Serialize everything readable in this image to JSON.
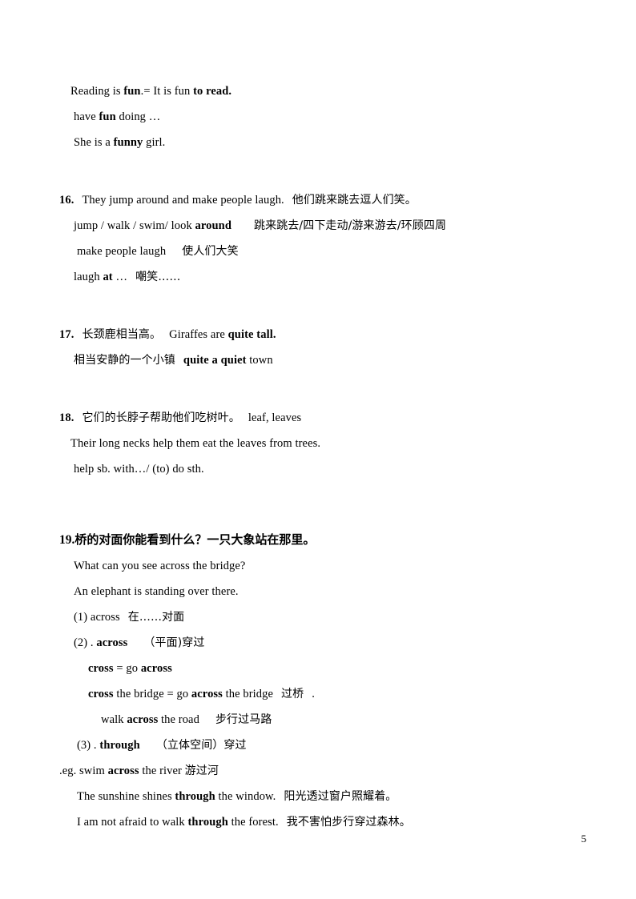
{
  "document": {
    "page_number": "5",
    "background_color": "#ffffff",
    "text_color": "#000000"
  },
  "blocks": {
    "intro": {
      "line1_a": "Reading is ",
      "line1_b": "fun",
      "line1_c": ".= It is fun ",
      "line1_d": "to read.",
      "line2_a": "have ",
      "line2_b": "fun",
      "line2_c": " doing …",
      "line3_a": "She is a ",
      "line3_b": "funny",
      "line3_c": " girl."
    },
    "item16": {
      "number": "16.",
      "title_en": "They jump around and make people laugh.",
      "title_cn": "他们跳来跳去逗人们笑。",
      "line2_a": "jump / walk / swim/ look ",
      "line2_b": "around",
      "line2_cn": "跳来跳去/四下走动/游来游去/环顾四周",
      "line3_en": "make people laugh",
      "line3_cn": "使人们大笑",
      "line4_a": "laugh ",
      "line4_b": "at",
      "line4_c": " …",
      "line4_cn": "嘲笑……"
    },
    "item17": {
      "number": "17.",
      "title_cn": "长颈鹿相当高。",
      "title_en_a": "Giraffes are ",
      "title_en_b": "quite tall.",
      "line2_cn": "相当安静的一个小镇",
      "line2_en_a": "quite a quiet",
      "line2_en_b": " town"
    },
    "item18": {
      "number": "18.",
      "title_cn": "它们的长脖子帮助他们吃树叶。",
      "title_en": "leaf, leaves",
      "line2_en": "Their long necks help them eat the leaves from trees.",
      "line3_en": "help sb. with…/ (to) do sth."
    },
    "item19": {
      "number": "19.",
      "heading_cn": "桥的对面你能看到什么？一只大象站在那里。",
      "line_q": "What can you see across the bridge?",
      "line_a": "An elephant is standing over there.",
      "sub1_en": "(1) across",
      "sub1_cn": "在……对面",
      "sub2_prefix": "(2) . ",
      "sub2_bold": "across",
      "sub2_cn": "（平面)穿过",
      "cross_eq_a": "cross",
      "cross_eq_b": " = go ",
      "cross_eq_c": "across",
      "cross_bridge_a": "cross",
      "cross_bridge_b": " the bridge = go ",
      "cross_bridge_c": "across",
      "cross_bridge_d": " the bridge",
      "cross_bridge_cn": "过桥",
      "cross_bridge_end": ".",
      "walk_across_a": "walk ",
      "walk_across_b": "across",
      "walk_across_c": " the road",
      "walk_across_cn": "步行过马路",
      "sub3_prefix": "(3) . ",
      "sub3_bold": "through",
      "sub3_cn": "（立体空间）穿过",
      "eg_a": ".eg. swim ",
      "eg_b": "across",
      "eg_c": " the river ",
      "eg_cn": "游过河",
      "ex1_a": "The sunshine shines ",
      "ex1_b": "through",
      "ex1_c": " the window.",
      "ex1_cn": "阳光透过窗户照耀着。",
      "ex2_a": "I am not afraid to walk ",
      "ex2_b": "through",
      "ex2_c": " the forest.",
      "ex2_cn": "我不害怕步行穿过森林。"
    }
  }
}
